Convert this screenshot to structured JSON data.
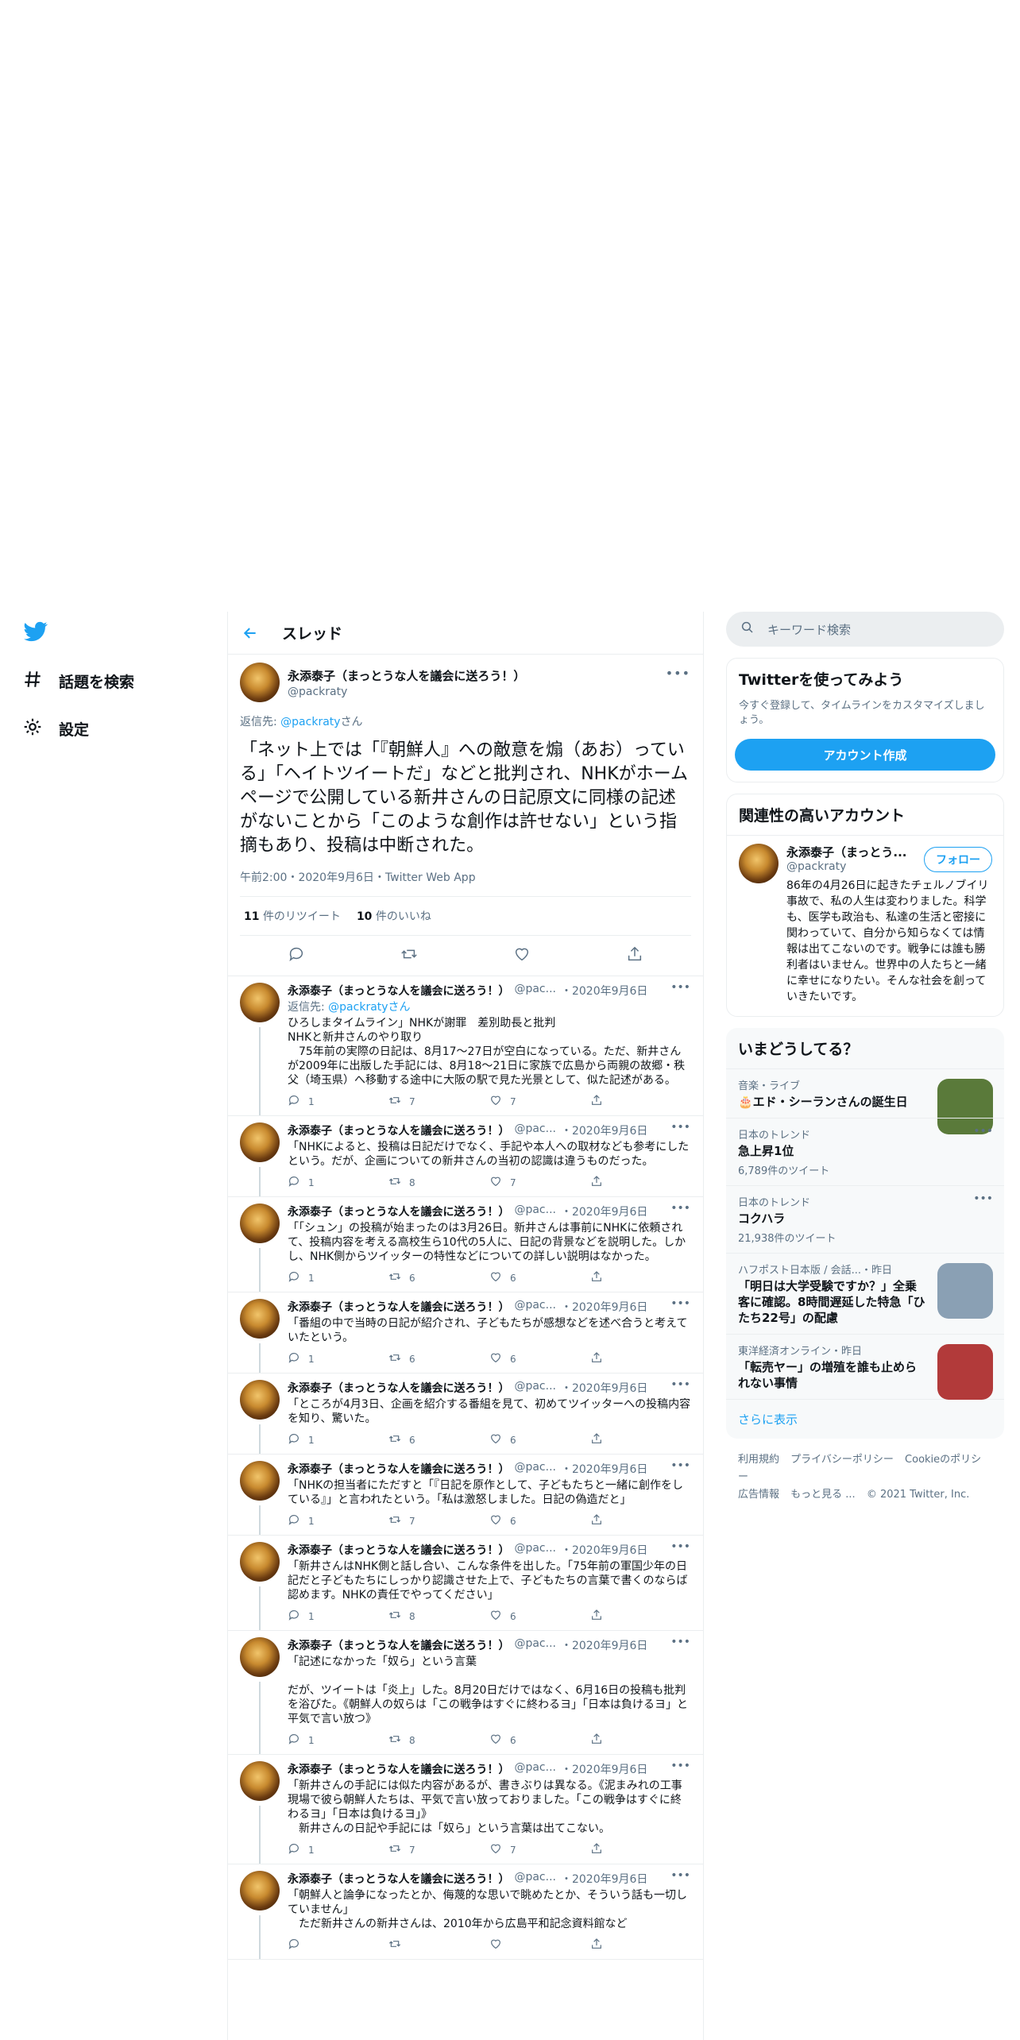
{
  "nav": {
    "items": [
      {
        "label": "話題を検索",
        "icon": "hashtag-icon"
      },
      {
        "label": "設定",
        "icon": "gear-icon"
      }
    ]
  },
  "header": {
    "title": "スレッド"
  },
  "focus": {
    "name": "永添泰子（まっとうな人を議会に送ろう！）",
    "handle": "@packraty",
    "reply_prefix": "返信先: ",
    "reply_handle": "@packraty",
    "reply_suffix": "さん",
    "text": "「ネット上では「『朝鮮人』への敵意を煽（あお）っている」「ヘイトツイートだ」などと批判され、NHKがホームページで公開している新井さんの日記原文に同様の記述がないことから「このような創作は許せない」という指摘もあり、投稿は中断された。",
    "meta": "午前2:00・2020年9月6日・Twitter Web App",
    "retweet_count": "11",
    "retweet_label": "件のリツイート",
    "like_count": "10",
    "like_label": "件のいいね"
  },
  "tweets": [
    {
      "name": "永添泰子（まっとうな人を議会に送ろう！）",
      "handle": "@pac...",
      "date": "・2020年9月6日",
      "reply": "@packratyさん",
      "text": "ひろしまタイムライン」NHKが謝罪　差別助長と批判\nNHKと新井さんのやり取り\n　75年前の実際の日記は、8月17～27日が空白になっている。ただ、新井さんが2009年に出版した手記には、8月18～21日に家族で広島から両親の故郷・秩父（埼玉県）へ移動する途中に大阪の駅で見た光景として、似た記述がある。",
      "replies": "1",
      "retweets": "7",
      "likes": "7"
    },
    {
      "name": "永添泰子（まっとうな人を議会に送ろう！）",
      "handle": "@pac...",
      "date": "・2020年9月6日",
      "reply": "",
      "text": "「NHKによると、投稿は日記だけでなく、手記や本人への取材なども参考にしたという。だが、企画についての新井さんの当初の認識は違うものだった。",
      "replies": "1",
      "retweets": "8",
      "likes": "7"
    },
    {
      "name": "永添泰子（まっとうな人を議会に送ろう！）",
      "handle": "@pac...",
      "date": "・2020年9月6日",
      "reply": "",
      "text": "「「シュン」の投稿が始まったのは3月26日。新井さんは事前にNHKに依頼されて、投稿内容を考える高校生ら10代の5人に、日記の背景などを説明した。しかし、NHK側からツイッターの特性などについての詳しい説明はなかった。",
      "replies": "1",
      "retweets": "6",
      "likes": "6"
    },
    {
      "name": "永添泰子（まっとうな人を議会に送ろう！）",
      "handle": "@pac...",
      "date": "・2020年9月6日",
      "reply": "",
      "text": "「番組の中で当時の日記が紹介され、子どもたちが感想などを述べ合うと考えていたという。",
      "replies": "1",
      "retweets": "6",
      "likes": "6"
    },
    {
      "name": "永添泰子（まっとうな人を議会に送ろう！）",
      "handle": "@pac...",
      "date": "・2020年9月6日",
      "reply": "",
      "text": "「ところが4月3日、企画を紹介する番組を見て、初めてツイッターへの投稿内容を知り、驚いた。",
      "replies": "1",
      "retweets": "6",
      "likes": "6"
    },
    {
      "name": "永添泰子（まっとうな人を議会に送ろう！）",
      "handle": "@pac...",
      "date": "・2020年9月6日",
      "reply": "",
      "text": "「NHKの担当者にただすと「『日記を原作として、子どもたちと一緒に創作をしている』」と言われたという。「私は激怒しました。日記の偽造だと」",
      "replies": "1",
      "retweets": "7",
      "likes": "6"
    },
    {
      "name": "永添泰子（まっとうな人を議会に送ろう！）",
      "handle": "@pac...",
      "date": "・2020年9月6日",
      "reply": "",
      "text": "「新井さんはNHK側と話し合い、こんな条件を出した。「75年前の軍国少年の日記だと子どもたちにしっかり認識させた上で、子どもたちの言葉で書くのならば認めます。NHKの責任でやってください」",
      "replies": "1",
      "retweets": "8",
      "likes": "6"
    },
    {
      "name": "永添泰子（まっとうな人を議会に送ろう！）",
      "handle": "@pac...",
      "date": "・2020年9月6日",
      "reply": "",
      "text": "「記述になかった「奴ら」という言葉\n\nだが、ツイートは「炎上」した。8月20日だけではなく、6月16日の投稿も批判を浴びた。《朝鮮人の奴らは「この戦争はすぐに終わるヨ」「日本は負けるヨ」と平気で言い放つ》",
      "replies": "1",
      "retweets": "8",
      "likes": "6"
    },
    {
      "name": "永添泰子（まっとうな人を議会に送ろう！）",
      "handle": "@pac...",
      "date": "・2020年9月6日",
      "reply": "",
      "text": "「新井さんの手記には似た内容があるが、書きぶりは異なる。《泥まみれの工事現場で彼ら朝鮮人たちは、平気で言い放っておりました。「この戦争はすぐに終わるヨ」「日本は負けるヨ」》\n　新井さんの日記や手記には「奴ら」という言葉は出てこない。",
      "replies": "1",
      "retweets": "7",
      "likes": "7"
    },
    {
      "name": "永添泰子（まっとうな人を議会に送ろう！）",
      "handle": "@pac...",
      "date": "・2020年9月6日",
      "reply": "",
      "text": "「朝鮮人と論争になったとか、侮蔑的な思いで眺めたとか、そういう話も一切していません」\n　ただ新井さんの新井さんは、2010年から広島平和記念資料館など",
      "replies": "",
      "retweets": "",
      "likes": ""
    }
  ],
  "right": {
    "search_placeholder": "キーワード検索",
    "try": {
      "title": "Twitterを使ってみよう",
      "subtitle": "今すぐ登録して、タイムラインをカスタマイズしましょう。",
      "button": "アカウント作成"
    },
    "related": {
      "title": "関連性の高いアカウント",
      "name": "永添泰子（まっとう...",
      "handle": "@packraty",
      "follow": "フォロー",
      "bio": "86年の4月26日に起きたチェルノブイリ事故で、私の人生は変わりました。科学も、医学も政治も、私達の生活と密接に関わっていて、自分から知らなくては情報は出てこないのです。戦争には誰も勝利者はいません。世界中の人たちと一緒に幸せになりたい。そんな社会を創っていきたいです。"
    },
    "trends": {
      "title": "いまどうしてる？",
      "items": [
        {
          "context": "音楽・ライブ",
          "title": "🎂エド・シーランさんの誕生日",
          "count": "",
          "thumb": "#5a7a3a"
        },
        {
          "context": "日本のトレンド",
          "title": "急上昇1位",
          "count": "6,789件のツイート",
          "thumb": ""
        },
        {
          "context": "日本のトレンド",
          "title": "コクハラ",
          "count": "21,938件のツイート",
          "thumb": ""
        },
        {
          "context": "ハフポスト日本版 / 会話...・昨日",
          "title": "「明日は大学受験ですか？」全乗客に確認。8時間遅延した特急「ひたち22号」の配慮",
          "count": "",
          "thumb": "#8aa0b4"
        },
        {
          "context": "東洋経済オンライン・昨日",
          "title": "「転売ヤー」の増殖を誰も止められない事情",
          "count": "",
          "thumb": "#b23a3a"
        }
      ],
      "show_more": "さらに表示"
    },
    "footer": {
      "links": [
        "利用規約",
        "プライバシーポリシー",
        "Cookieのポリシー",
        "広告情報",
        "もっと見る ..."
      ],
      "copyright": "© 2021 Twitter, Inc."
    }
  }
}
